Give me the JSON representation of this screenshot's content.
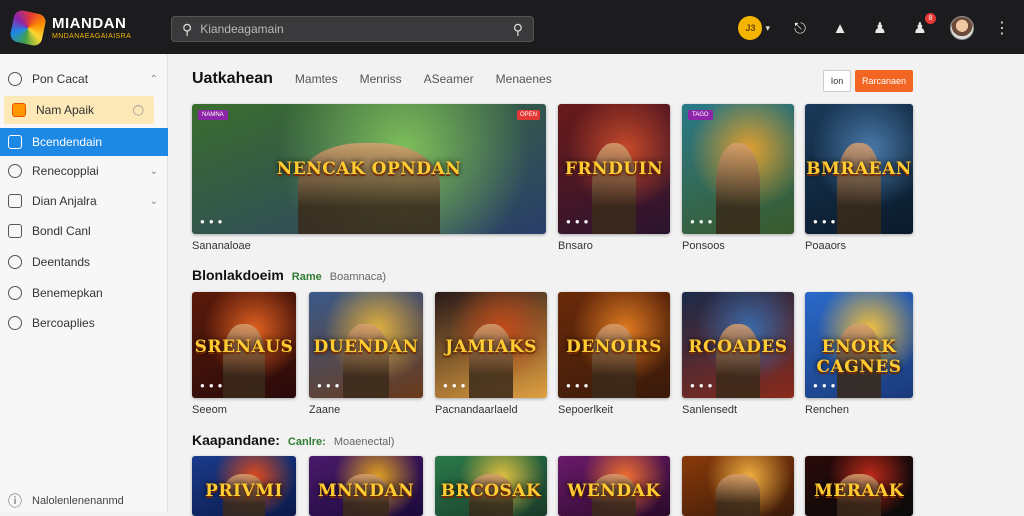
{
  "header": {
    "logo_title": "MIANDAN",
    "logo_subtitle": "MNDANAEAGAIAISRA",
    "search_placeholder": "Kiandeagamain",
    "coin_label": "J3",
    "coin_arrow": "▾",
    "notification_count": "8"
  },
  "sidebar": {
    "items": [
      {
        "label": "Pon Cacat",
        "chevron": "⌃"
      },
      {
        "label": "Nam Apaik",
        "chevron": "◯"
      },
      {
        "label": "Bcendendain",
        "chevron": ""
      },
      {
        "label": "Renecopplai",
        "chevron": "⌄"
      },
      {
        "label": "Dian Anjalra",
        "chevron": "⌄"
      },
      {
        "label": "Bondl Canl",
        "chevron": ""
      },
      {
        "label": "Deentands",
        "chevron": ""
      },
      {
        "label": "Benemepkan",
        "chevron": ""
      },
      {
        "label": "Bercoaplies",
        "chevron": ""
      }
    ],
    "footer": "Nalolenlenenanmd"
  },
  "main": {
    "page_title": "Uatkahean",
    "tabs": [
      "Mamtes",
      "Menriss",
      "ASeamer",
      "Menaenes"
    ],
    "btn_ghost": "Ion",
    "btn_primary": "Rarcanaen",
    "featured": {
      "cards": [
        {
          "art": "NENCAK OPNDAN",
          "caption": "Sananaloae",
          "tag": "NAMNA",
          "tag_r": "OPEN",
          "colors": [
            "#3b6d2e",
            "#7fbf5a",
            "#2a3f6b"
          ]
        },
        {
          "art": "FRNDUIN",
          "caption": "Bnsaro",
          "tag": "",
          "tag_r": "",
          "colors": [
            "#6a1a1a",
            "#c84a2a",
            "#2a1430"
          ]
        },
        {
          "art": "",
          "caption": "Ponsoos",
          "tag": "TAGO",
          "tag_r": "",
          "colors": [
            "#2a7a8a",
            "#e0a030",
            "#3a5a2a"
          ]
        },
        {
          "art": "BMRAEAN",
          "caption": "Poaaors",
          "tag": "",
          "tag_r": "",
          "colors": [
            "#1a3a5a",
            "#4a7aaa",
            "#0a1a2a"
          ]
        }
      ]
    },
    "section2": {
      "title": "Blonlakdoeim",
      "green": "Rame",
      "muted": "Boamnaca)",
      "cards": [
        {
          "art": "SRENAUS",
          "caption": "Seeom",
          "colors": [
            "#5a1a0a",
            "#e06020",
            "#2a0a0a"
          ]
        },
        {
          "art": "DUENDAN",
          "caption": "Zaane",
          "colors": [
            "#3a5a8a",
            "#e0b040",
            "#6a3a1a"
          ]
        },
        {
          "art": "JAMIAKS",
          "caption": "Pacnandaarlaeld",
          "colors": [
            "#2a1a1a",
            "#c04a1a",
            "#e0a040"
          ]
        },
        {
          "art": "DENOIRS",
          "caption": "Sepoerlkeit",
          "colors": [
            "#6a2a0a",
            "#e07a20",
            "#3a1a0a"
          ]
        },
        {
          "art": "RCOADES",
          "caption": "Sanlensedt",
          "colors": [
            "#1a2a4a",
            "#3a6aaa",
            "#8a2a1a"
          ]
        },
        {
          "art": "ENORK CAGNES",
          "caption": "Renchen",
          "colors": [
            "#2a6aca",
            "#f0c040",
            "#1a3a7a"
          ]
        }
      ]
    },
    "section3": {
      "title": "Kaapandane:",
      "green": "Canlre:",
      "muted": "Moaenectal)",
      "cards": [
        {
          "art": "PRIVMI",
          "colors": [
            "#1a3a8a",
            "#e04a1a",
            "#0a1a4a"
          ]
        },
        {
          "art": "MNNDAN",
          "colors": [
            "#4a1a6a",
            "#e0a020",
            "#1a0a3a"
          ]
        },
        {
          "art": "BRCOSAK",
          "colors": [
            "#2a7a4a",
            "#e0c040",
            "#1a3a2a"
          ]
        },
        {
          "art": "WENDAK",
          "colors": [
            "#6a1a6a",
            "#f07030",
            "#2a0a2a"
          ]
        },
        {
          "art": "",
          "colors": [
            "#8a3a0a",
            "#f0b040",
            "#3a1a0a"
          ]
        },
        {
          "art": "MERAAK",
          "colors": [
            "#2a0a0a",
            "#c02a1a",
            "#0a0a0a"
          ]
        }
      ]
    }
  }
}
